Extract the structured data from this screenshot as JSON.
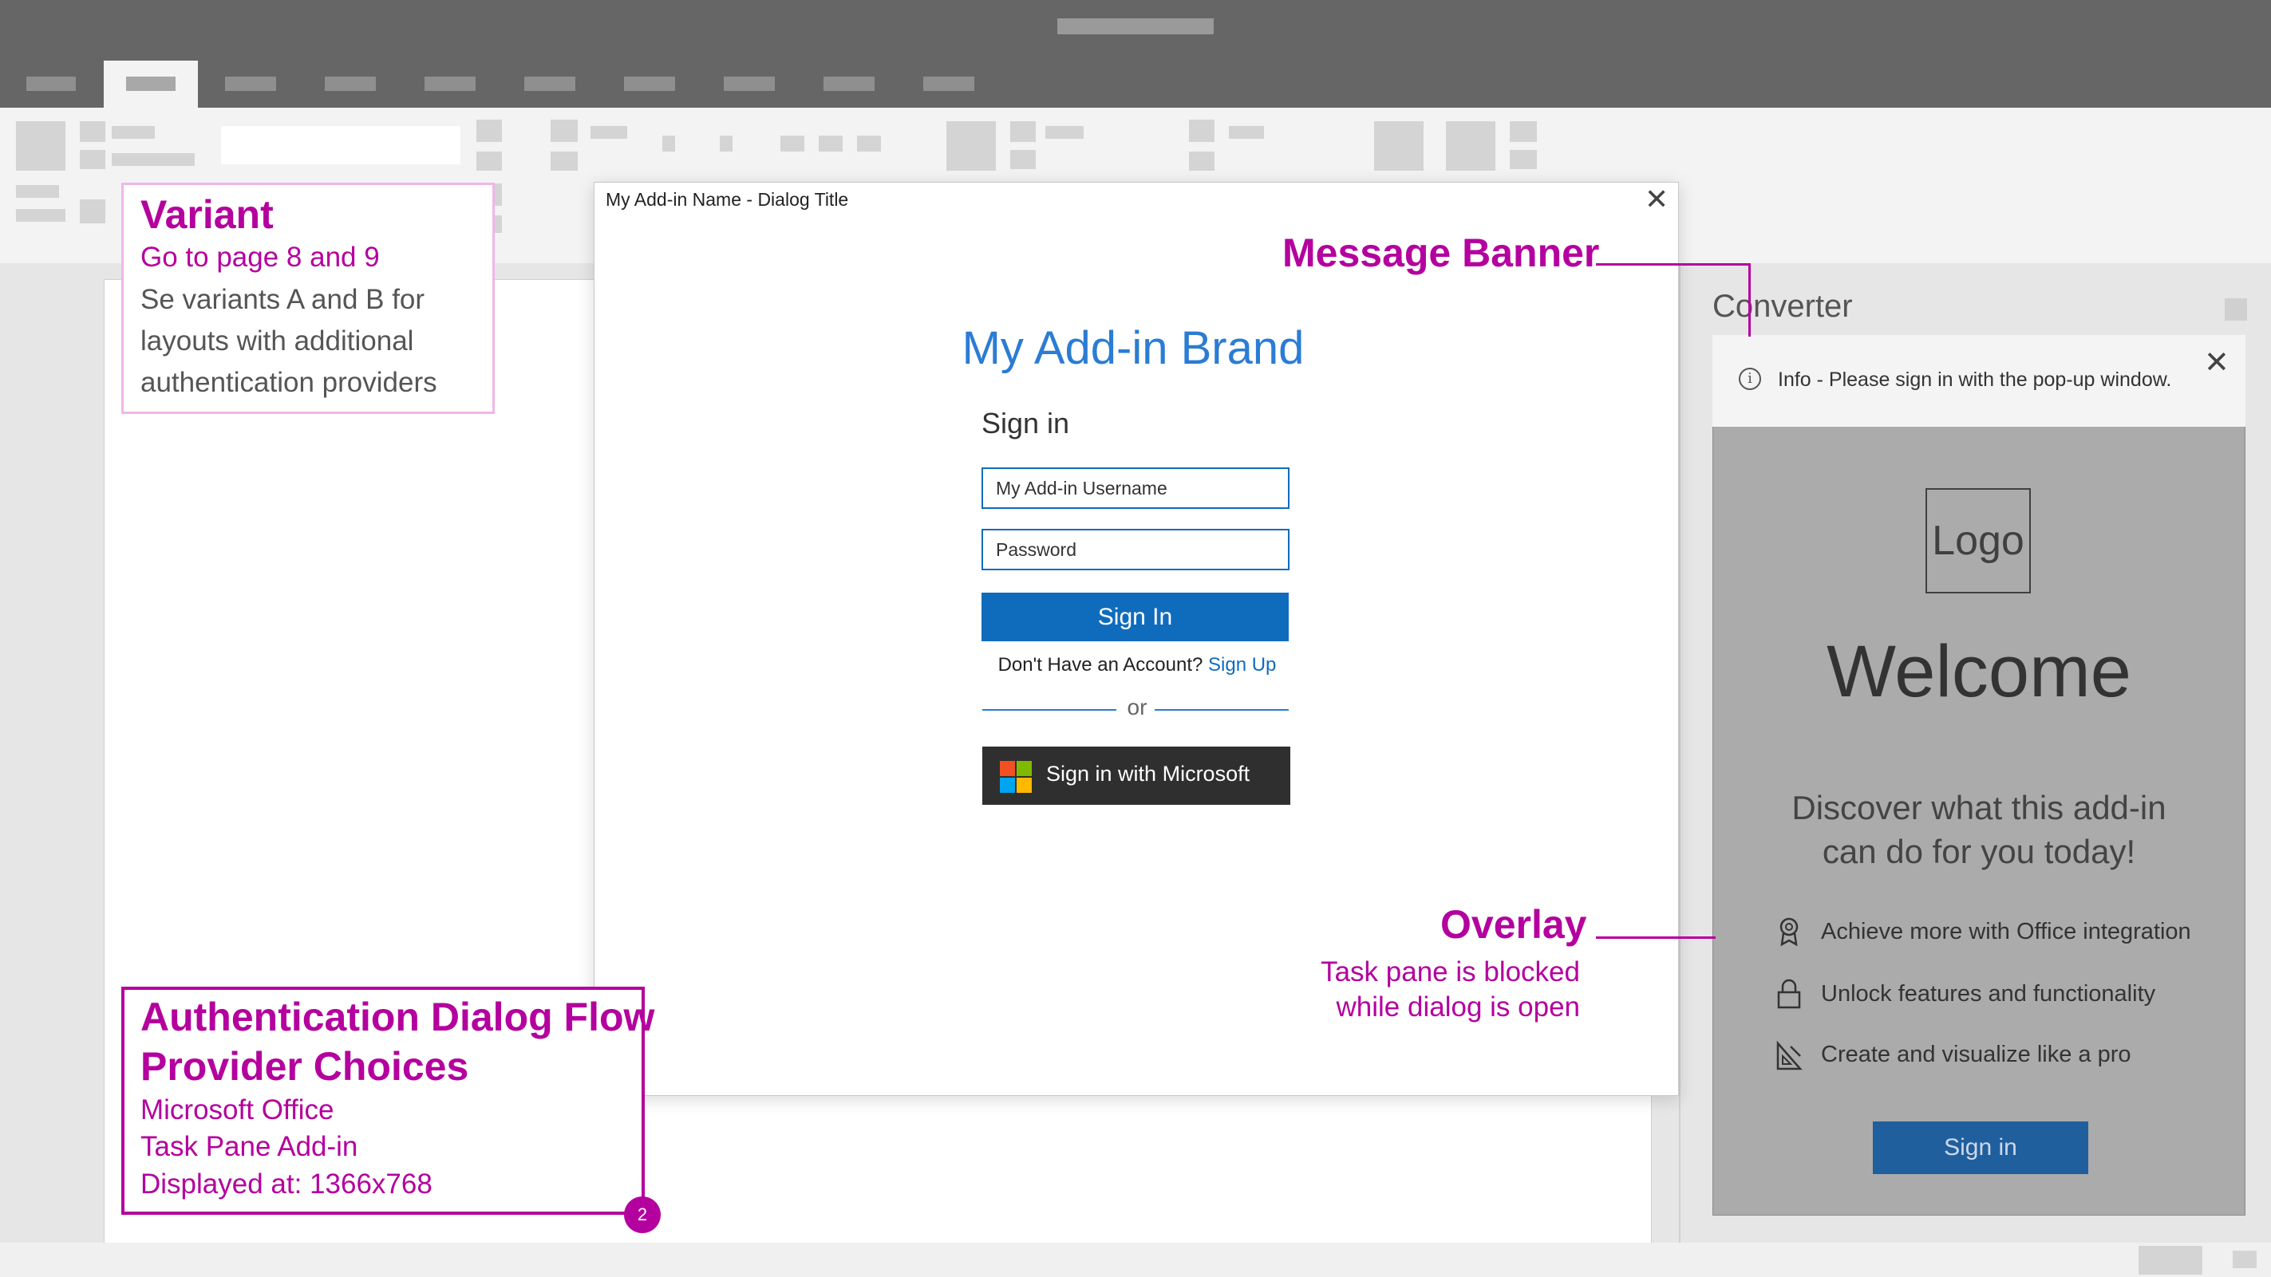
{
  "dialog": {
    "title": "My Add-in Name - Dialog Title",
    "close_glyph": "✕",
    "brand": "My Add-in Brand",
    "heading": "Sign in",
    "username_placeholder": "My Add-in Username",
    "password_placeholder": "Password",
    "signin_button": "Sign In",
    "no_account_text": "Don't Have an Account?",
    "signup_link": "Sign Up",
    "or_text": "or",
    "microsoft_button": "Sign in with Microsoft",
    "microsoft_logo_colors": [
      "#f25022",
      "#7fba00",
      "#00a4ef",
      "#ffb900"
    ]
  },
  "task_pane": {
    "title": "Converter",
    "banner_text": "Info - Please sign in with the pop-up window.",
    "banner_close_glyph": "✕",
    "logo_text": "Logo",
    "welcome": "Welcome",
    "discover_line1": "Discover what this add-in",
    "discover_line2": "can do for you today!",
    "features": [
      {
        "label": "Achieve more with Office integration",
        "icon": "ribbon-award-icon"
      },
      {
        "label": "Unlock features and functionality",
        "icon": "lock-icon"
      },
      {
        "label": "Create and visualize like a pro",
        "icon": "design-ruler-icon"
      }
    ],
    "signin_button": "Sign in"
  },
  "annotations": {
    "variant": {
      "title": "Variant",
      "subtitle": "Go to page 8 and 9",
      "lines": [
        "Se variants A and B for",
        "layouts with additional",
        "authentication providers"
      ]
    },
    "message_banner": "Message Banner",
    "overlay": {
      "title": "Overlay",
      "line1": "Task pane is blocked",
      "line2": "while dialog is open"
    },
    "flow": {
      "title_line1": "Authentication Dialog Flow",
      "title_line2": "Provider Choices",
      "lines": [
        "Microsoft Office",
        "Task Pane Add-in",
        "Displayed at: 1366x768"
      ],
      "badge": "2"
    }
  },
  "colors": {
    "accent": "#0f6cbd",
    "brand_blue": "#2b7cd3",
    "annotation": "#b4009e",
    "title_bar": "#666666",
    "overlay": "#ababab"
  }
}
